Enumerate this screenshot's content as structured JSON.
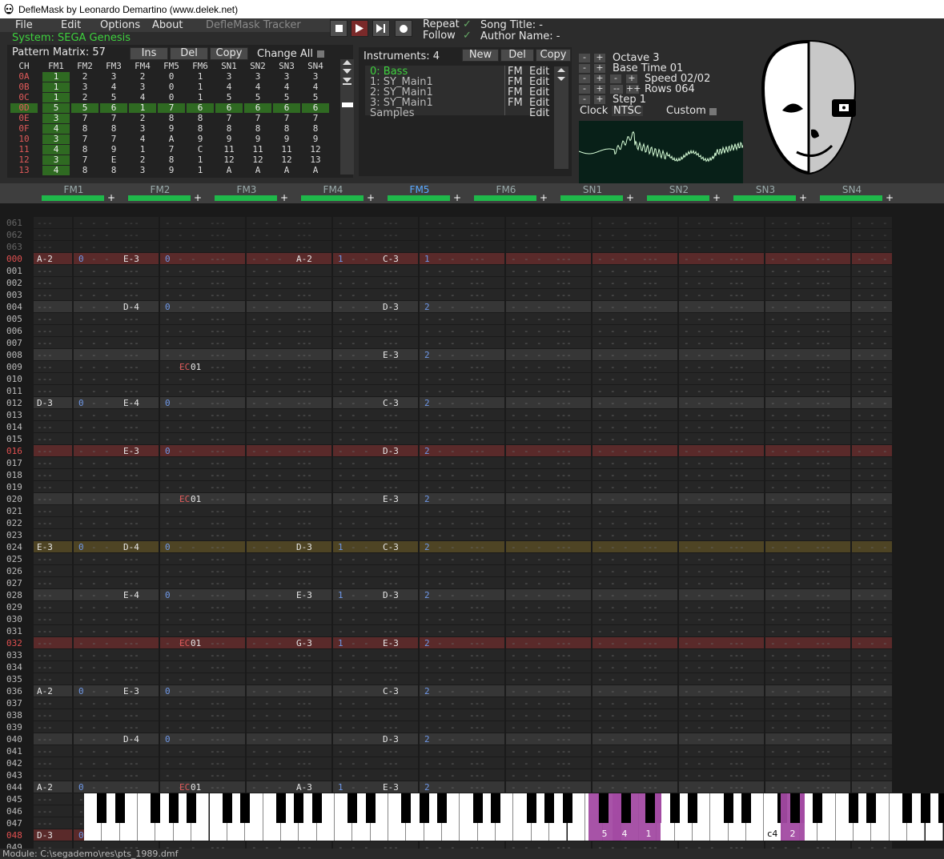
{
  "window": {
    "title": "DefleMask by Leonardo Demartino (www.delek.net)"
  },
  "menu": {
    "file": "File",
    "edit": "Edit",
    "options": "Options",
    "about": "About",
    "app_title": "DefleMask Tracker"
  },
  "song": {
    "repeat_label": "Repeat",
    "repeat_checked": true,
    "follow_label": "Follow",
    "follow_checked": true,
    "title_label": "Song Title: -",
    "author_label": "Author Name: -"
  },
  "system": {
    "label": "System: SEGA Genesis"
  },
  "pattern_matrix": {
    "title": "Pattern Matrix: 57",
    "ins_label": "Ins",
    "del_label": "Del",
    "copy_label": "Copy",
    "change_all_label": "Change All",
    "columns": [
      "CH",
      "FM1",
      "FM2",
      "FM3",
      "FM4",
      "FM5",
      "FM6",
      "SN1",
      "SN2",
      "SN3",
      "SN4"
    ],
    "rows": [
      [
        "0A",
        "1",
        "2",
        "3",
        "2",
        "0",
        "1",
        "3",
        "3",
        "3",
        "3"
      ],
      [
        "0B",
        "1",
        "3",
        "4",
        "3",
        "0",
        "1",
        "4",
        "4",
        "4",
        "4"
      ],
      [
        "0C",
        "1",
        "2",
        "5",
        "4",
        "0",
        "1",
        "5",
        "5",
        "5",
        "5"
      ],
      [
        "0D",
        "5",
        "5",
        "6",
        "1",
        "7",
        "6",
        "6",
        "6",
        "6",
        "6"
      ],
      [
        "0E",
        "3",
        "7",
        "7",
        "2",
        "8",
        "8",
        "7",
        "7",
        "7",
        "7"
      ],
      [
        "0F",
        "4",
        "8",
        "8",
        "3",
        "9",
        "8",
        "8",
        "8",
        "8",
        "8"
      ],
      [
        "10",
        "3",
        "7",
        "7",
        "4",
        "A",
        "9",
        "9",
        "9",
        "9",
        "9"
      ],
      [
        "11",
        "4",
        "8",
        "9",
        "1",
        "7",
        "C",
        "11",
        "11",
        "11",
        "12"
      ],
      [
        "12",
        "3",
        "7",
        "E",
        "2",
        "8",
        "1",
        "12",
        "12",
        "12",
        "13"
      ],
      [
        "13",
        "4",
        "8",
        "8",
        "3",
        "9",
        "1",
        "A",
        "A",
        "A",
        "A"
      ]
    ]
  },
  "instruments": {
    "title": "Instruments: 4",
    "new_label": "New",
    "del_label": "Del",
    "copy_label": "Copy",
    "items": [
      {
        "name": "0: Bass",
        "type": "FM",
        "edit": "Edit"
      },
      {
        "name": "1: SY_Main1",
        "type": "FM",
        "edit": "Edit"
      },
      {
        "name": "2: SY_Main1",
        "type": "FM",
        "edit": "Edit"
      },
      {
        "name": "3: SY_Main1",
        "type": "FM",
        "edit": "Edit"
      },
      {
        "name": "Samples",
        "type": "",
        "edit": "Edit"
      }
    ]
  },
  "controls": {
    "octave": "Octave 3",
    "base_time": "Base Time 01",
    "speed": "Speed 02/02",
    "rows": "Rows 064",
    "step": "Step 1",
    "clock_label": "Clock",
    "clock_value": "NTSC",
    "custom_label": "Custom"
  },
  "channels": [
    "FM1",
    "FM2",
    "FM3",
    "FM4",
    "FM5",
    "FM6",
    "SN1",
    "SN2",
    "SN3",
    "SN4"
  ],
  "pattern": {
    "rows": [
      {
        "n": "061"
      },
      {
        "n": "062"
      },
      {
        "n": "063"
      },
      {
        "n": "000",
        "c": [
          [
            "A-2",
            "0",
            "",
            ""
          ],
          [
            "E-3",
            "0",
            "",
            ""
          ],
          null,
          [
            "A-2",
            "1",
            "",
            ""
          ],
          [
            "C-3",
            "1",
            "",
            ""
          ],
          null,
          null,
          null,
          null,
          null
        ]
      },
      {
        "n": "001"
      },
      {
        "n": "002"
      },
      {
        "n": "003"
      },
      {
        "n": "004",
        "c": [
          null,
          [
            "D-4",
            "0",
            "",
            ""
          ],
          null,
          null,
          [
            "D-3",
            "2",
            "",
            ""
          ],
          null,
          null,
          null,
          null,
          null
        ]
      },
      {
        "n": "005"
      },
      {
        "n": "006"
      },
      {
        "n": "007"
      },
      {
        "n": "008",
        "c": [
          null,
          null,
          null,
          null,
          [
            "E-3",
            "2",
            "",
            ""
          ],
          null,
          null,
          null,
          null,
          null
        ]
      },
      {
        "n": "009",
        "c": [
          null,
          [
            "",
            "",
            "EC",
            "01"
          ],
          null,
          null,
          null,
          null,
          null,
          null,
          null,
          null
        ]
      },
      {
        "n": "010"
      },
      {
        "n": "011"
      },
      {
        "n": "012",
        "c": [
          [
            "D-3",
            "0",
            "",
            ""
          ],
          [
            "E-4",
            "0",
            "",
            ""
          ],
          null,
          null,
          [
            "C-3",
            "2",
            "",
            ""
          ],
          null,
          null,
          null,
          null,
          null
        ]
      },
      {
        "n": "013"
      },
      {
        "n": "014"
      },
      {
        "n": "015"
      },
      {
        "n": "016",
        "c": [
          null,
          [
            "E-3",
            "0",
            "",
            ""
          ],
          null,
          null,
          [
            "D-3",
            "2",
            "",
            ""
          ],
          null,
          null,
          null,
          null,
          null
        ]
      },
      {
        "n": "017"
      },
      {
        "n": "018"
      },
      {
        "n": "019"
      },
      {
        "n": "020",
        "c": [
          null,
          [
            "",
            "",
            "EC",
            "01"
          ],
          null,
          null,
          [
            "E-3",
            "2",
            "",
            ""
          ],
          null,
          null,
          null,
          null,
          null
        ]
      },
      {
        "n": "021"
      },
      {
        "n": "022"
      },
      {
        "n": "023"
      },
      {
        "n": "024",
        "c": [
          [
            "E-3",
            "0",
            "",
            ""
          ],
          [
            "D-4",
            "0",
            "",
            ""
          ],
          null,
          [
            "D-3",
            "1",
            "",
            ""
          ],
          [
            "C-3",
            "2",
            "",
            ""
          ],
          null,
          null,
          null,
          null,
          null
        ]
      },
      {
        "n": "025"
      },
      {
        "n": "026"
      },
      {
        "n": "027"
      },
      {
        "n": "028",
        "c": [
          null,
          [
            "E-4",
            "0",
            "",
            ""
          ],
          null,
          [
            "E-3",
            "1",
            "",
            ""
          ],
          [
            "D-3",
            "2",
            "",
            ""
          ],
          null,
          null,
          null,
          null,
          null
        ]
      },
      {
        "n": "029"
      },
      {
        "n": "030"
      },
      {
        "n": "031"
      },
      {
        "n": "032",
        "c": [
          null,
          [
            "",
            "",
            "EC",
            "01"
          ],
          null,
          [
            "G-3",
            "1",
            "",
            ""
          ],
          [
            "E-3",
            "2",
            "",
            ""
          ],
          null,
          null,
          null,
          null,
          null
        ]
      },
      {
        "n": "033"
      },
      {
        "n": "034"
      },
      {
        "n": "035"
      },
      {
        "n": "036",
        "c": [
          [
            "A-2",
            "0",
            "",
            ""
          ],
          [
            "E-3",
            "0",
            "",
            ""
          ],
          null,
          null,
          [
            "C-3",
            "2",
            "",
            ""
          ],
          null,
          null,
          null,
          null,
          null
        ]
      },
      {
        "n": "037"
      },
      {
        "n": "038"
      },
      {
        "n": "039"
      },
      {
        "n": "040",
        "c": [
          null,
          [
            "D-4",
            "0",
            "",
            ""
          ],
          null,
          null,
          [
            "D-3",
            "2",
            "",
            ""
          ],
          null,
          null,
          null,
          null,
          null
        ]
      },
      {
        "n": "041"
      },
      {
        "n": "042"
      },
      {
        "n": "043"
      },
      {
        "n": "044",
        "c": [
          [
            "A-2",
            "0",
            "",
            ""
          ],
          [
            "",
            "",
            "EC",
            "01"
          ],
          null,
          [
            "A-3",
            "1",
            "",
            ""
          ],
          [
            "E-3",
            "2",
            "",
            ""
          ],
          null,
          null,
          null,
          null,
          null
        ]
      },
      {
        "n": "045"
      },
      {
        "n": "046"
      },
      {
        "n": "047"
      },
      {
        "n": "048",
        "c": [
          [
            "D-3",
            "0",
            "",
            ""
          ],
          null,
          null,
          null,
          null,
          null,
          null,
          null,
          null,
          null
        ]
      },
      {
        "n": "049"
      }
    ]
  },
  "piano": {
    "labels": {
      "5": "5",
      "4": "4",
      "1": "1",
      "c4": "c4",
      "2": "2"
    }
  },
  "status": {
    "text": "Module: C:\\segademo\\res\\pts_1989.dmf"
  },
  "colors": {
    "accent_green": "#3ed13e",
    "bar_green": "#1fb84a",
    "row_red": "#5a2a2a",
    "cursor_row": "#4e4424",
    "note_white": "#e6e6e6",
    "inst_blue": "#6f98e8",
    "effect_red": "#e05a5a",
    "piano_active": "#a34aa3"
  }
}
